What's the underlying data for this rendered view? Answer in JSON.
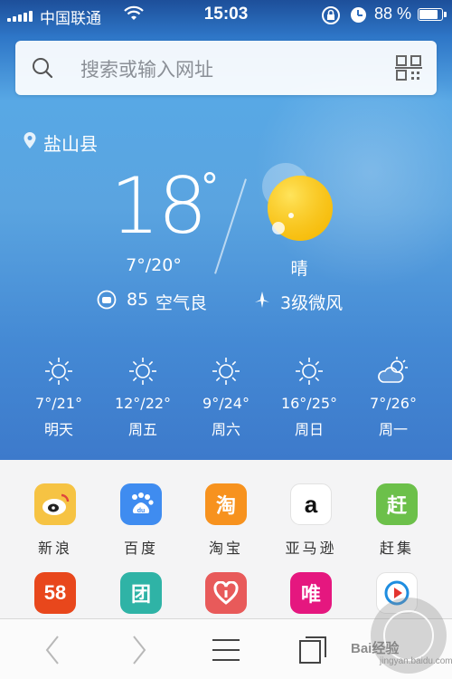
{
  "status_bar": {
    "carrier": "中国联通",
    "time": "15:03",
    "battery_percent": "88 %",
    "battery_level": 0.88
  },
  "search": {
    "placeholder": "搜索或输入网址"
  },
  "weather": {
    "location": "盐山县",
    "temperature": "18",
    "degree_symbol": "°",
    "range": "7°/20°",
    "condition": "晴",
    "aqi_value": "85",
    "aqi_text": "空气良",
    "wind": "3级微风",
    "forecast": [
      {
        "range": "7°/21°",
        "day": "明天",
        "icon": "sun-icon"
      },
      {
        "range": "12°/22°",
        "day": "周五",
        "icon": "sun-icon"
      },
      {
        "range": "9°/24°",
        "day": "周六",
        "icon": "sun-icon"
      },
      {
        "range": "16°/25°",
        "day": "周日",
        "icon": "sun-icon"
      },
      {
        "range": "7°/26°",
        "day": "周一",
        "icon": "partly-cloudy-icon"
      }
    ]
  },
  "shortcuts": [
    {
      "label": "新浪",
      "icon": "sina-weibo-icon",
      "color": "#f6c343"
    },
    {
      "label": "百度",
      "icon": "baidu-icon",
      "color": "#3f8cf0"
    },
    {
      "label": "淘宝",
      "icon": "taobao-icon",
      "glyph": "淘",
      "color": "#f7921e"
    },
    {
      "label": "亚马逊",
      "icon": "amazon-icon",
      "glyph": "a",
      "color": "#ffffff"
    },
    {
      "label": "赶集",
      "icon": "ganji-icon",
      "glyph": "赶",
      "color": "#6cc04a"
    },
    {
      "label": "",
      "icon": "58-icon",
      "glyph": "58",
      "color": "#e8471c"
    },
    {
      "label": "",
      "icon": "tuan-icon",
      "glyph": "团",
      "color": "#2fb3a6"
    },
    {
      "label": "",
      "icon": "heart-app-icon",
      "color": "#e85a5a"
    },
    {
      "label": "",
      "icon": "vip-icon",
      "glyph": "唯",
      "color": "#e5177f"
    },
    {
      "label": "",
      "icon": "video-play-icon",
      "color": "#ffffff"
    }
  ],
  "watermark": {
    "text": "Bai经验",
    "sub": "jingyan.baidu.com"
  }
}
